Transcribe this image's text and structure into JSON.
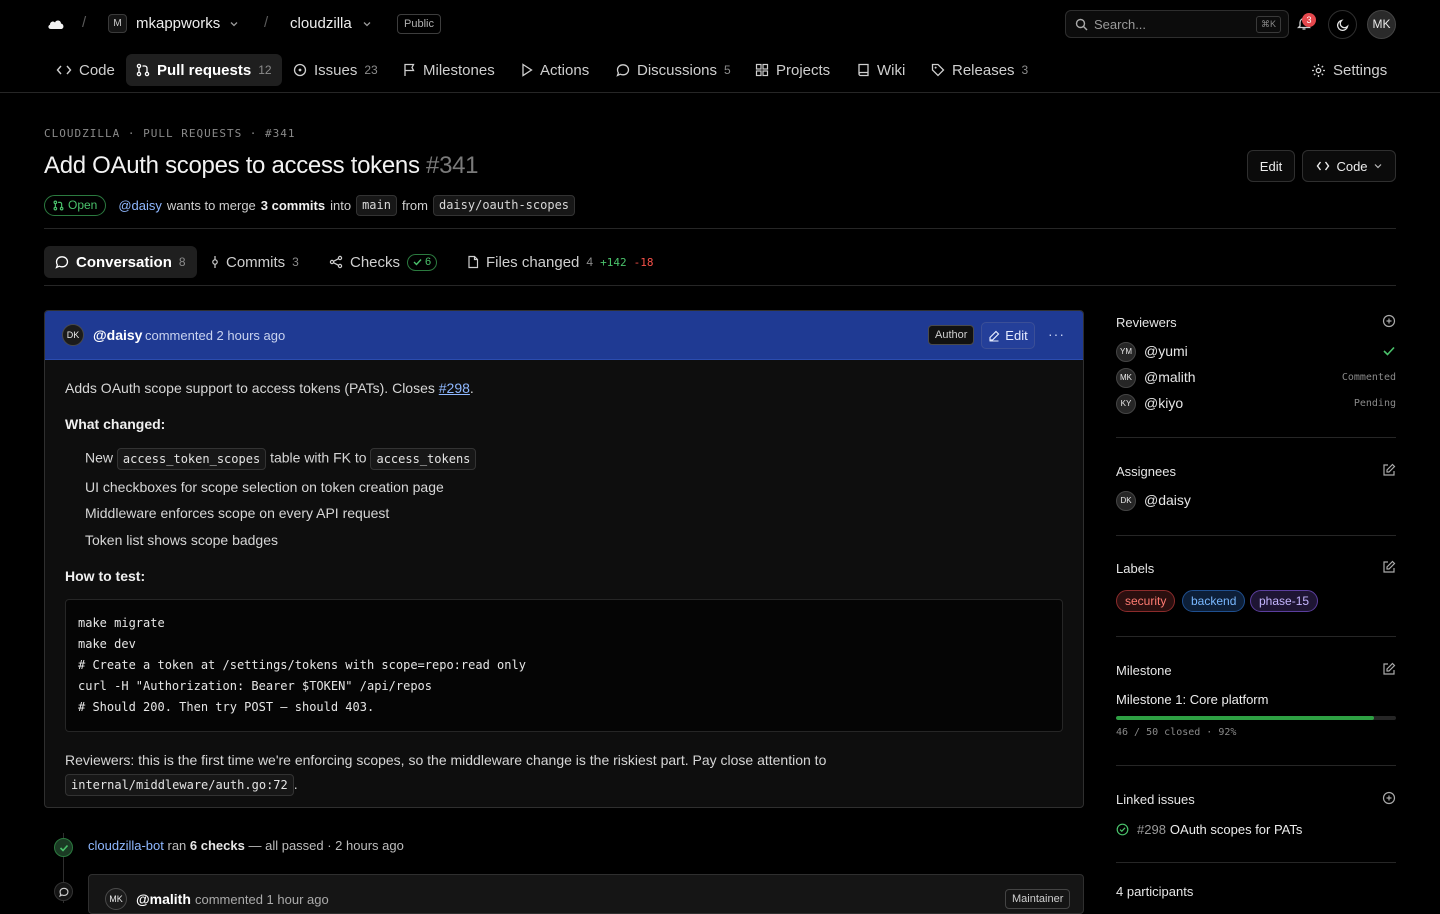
{
  "header": {
    "org": "mkappworks",
    "org_initial": "M",
    "repo": "cloudzilla",
    "visibility": "Public",
    "search_placeholder": "Search...",
    "search_shortcut": "⌘K",
    "notification_count": "3",
    "user_initials": "MK"
  },
  "repo_nav": [
    {
      "label": "Code",
      "count": "",
      "icon": "code-icon"
    },
    {
      "label": "Pull requests",
      "count": "12",
      "icon": "pull-request-icon"
    },
    {
      "label": "Issues",
      "count": "23",
      "icon": "issue-icon"
    },
    {
      "label": "Milestones",
      "count": "",
      "icon": "milestone-icon"
    },
    {
      "label": "Actions",
      "count": "",
      "icon": "play-icon"
    },
    {
      "label": "Discussions",
      "count": "5",
      "icon": "discussion-icon"
    },
    {
      "label": "Projects",
      "count": "",
      "icon": "projects-icon"
    },
    {
      "label": "Wiki",
      "count": "",
      "icon": "book-icon"
    },
    {
      "label": "Releases",
      "count": "3",
      "icon": "tag-icon"
    },
    {
      "label": "Settings",
      "count": "",
      "icon": "gear-icon"
    }
  ],
  "pr": {
    "breadcrumb": "CLOUDZILLA · PULL REQUESTS · #341",
    "title": "Add OAuth scopes to access tokens",
    "number": "#341",
    "edit_label": "Edit",
    "code_label": "Code",
    "state": "Open",
    "author": "@daisy",
    "merge_text_1": "wants to merge",
    "commits_text": "3 commits",
    "merge_text_2": "into",
    "base_branch": "main",
    "merge_text_3": "from",
    "head_branch": "daisy/oauth-scopes"
  },
  "tabs": {
    "conversation": {
      "label": "Conversation",
      "count": "8"
    },
    "commits": {
      "label": "Commits",
      "count": "3"
    },
    "checks": {
      "label": "Checks",
      "count": "6"
    },
    "files": {
      "label": "Files changed",
      "count": "4",
      "additions": "+142",
      "deletions": "-18"
    }
  },
  "comment": {
    "initials": "DK",
    "user": "@daisy",
    "meta": "commented 2 hours ago",
    "badge": "Author",
    "edit_label": "Edit",
    "more": "···",
    "intro_1": "Adds OAuth scope support to access tokens (PATs). Closes",
    "intro_link": "#298",
    "intro_2": ".",
    "h_changed": "What changed:",
    "item1_a": "New",
    "item1_code1": "access_token_scopes",
    "item1_b": "table with FK to",
    "item1_code2": "access_tokens",
    "item2": "UI checkboxes for scope selection on token creation page",
    "item3": "Middleware enforces scope on every API request",
    "item4": "Token list shows scope badges",
    "h_test": "How to test:",
    "code_lines": [
      "make migrate",
      "make dev",
      "# Create a token at /settings/tokens with scope=repo:read only",
      "curl -H \"Authorization: Bearer $TOKEN\" /api/repos",
      "# Should 200. Then try POST — should 403."
    ],
    "footer_text": "Reviewers: this is the first time we're enforcing scopes, so the middleware change is the riskiest part. Pay close attention to",
    "footer_code": "internal/middleware/auth.go:72",
    "footer_end": "."
  },
  "timeline": {
    "bot": "cloudzilla-bot",
    "ran": "ran",
    "checks": "6 checks",
    "rest": "— all passed · 2 hours ago",
    "next_initials": "MK",
    "next_user": "@malith",
    "next_meta": "commented 1 hour ago",
    "next_badge": "Maintainer"
  },
  "sidebar": {
    "reviewers_title": "Reviewers",
    "reviewers": [
      {
        "initials": "YM",
        "name": "@yumi",
        "status": "approved"
      },
      {
        "initials": "MK",
        "name": "@malith",
        "status": "Commented"
      },
      {
        "initials": "KY",
        "name": "@kiyo",
        "status": "Pending"
      }
    ],
    "assignees_title": "Assignees",
    "assignee": {
      "initials": "DK",
      "name": "@daisy"
    },
    "labels_title": "Labels",
    "labels": [
      {
        "name": "security",
        "color": "#f85149"
      },
      {
        "name": "backend",
        "color": "#58a6ff"
      },
      {
        "name": "phase-15",
        "color": "#a78bfa"
      }
    ],
    "milestone_title": "Milestone",
    "milestone_name": "Milestone 1: Core platform",
    "milestone_progress": 0.92,
    "milestone_meta": "46 / 50 closed · 92%",
    "linked_title": "Linked issues",
    "linked_number": "#298",
    "linked_name": "OAuth scopes for PATs",
    "participants": "4 participants"
  },
  "colors": {
    "accent_blue": "#1f3a93",
    "link": "#8fb8ff",
    "success": "#4ac26b",
    "danger": "#f85149"
  }
}
